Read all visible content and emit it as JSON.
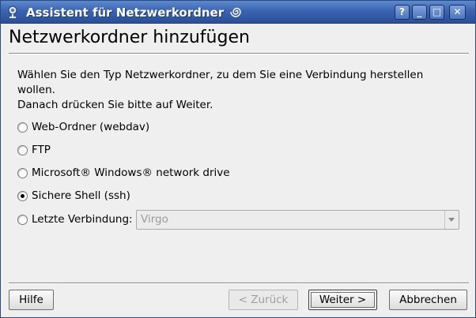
{
  "titlebar": {
    "title": "Assistent für Netzwerkordner",
    "buttons": {
      "help": "?",
      "minimize": "_",
      "maximize": "□",
      "close": "✕"
    }
  },
  "page": {
    "heading": "Netzwerkordner hinzufügen",
    "description_line1": "Wählen Sie den Typ Netzwerkordner, zu dem Sie eine Verbindung herstellen wollen.",
    "description_line2": "Danach drücken Sie bitte auf Weiter."
  },
  "options": [
    {
      "label": "Web-Ordner (webdav)",
      "checked": false
    },
    {
      "label": "FTP",
      "checked": false
    },
    {
      "label": "Microsoft® Windows® network drive",
      "checked": false
    },
    {
      "label": "Sichere Shell (ssh)",
      "checked": true
    },
    {
      "label": "Letzte Verbindung:",
      "checked": false
    }
  ],
  "recent_connection": {
    "value": "Virgo",
    "enabled": false
  },
  "buttons": {
    "help": "Hilfe",
    "back": "< Zurück",
    "next": "Weiter >",
    "cancel": "Abbrechen"
  },
  "colors": {
    "titlebar": "#3b64b0",
    "window_bg": "#efefef"
  }
}
